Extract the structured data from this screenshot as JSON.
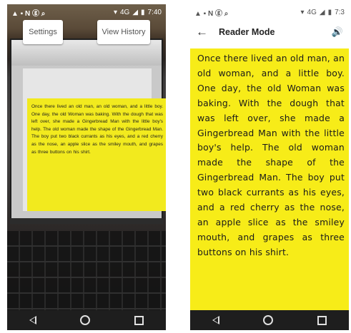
{
  "status_bar": {
    "left_icons": "▲ ▪ N ⓖ ⌕",
    "time_left": "7:40",
    "time_right": "7:3",
    "network": "4G"
  },
  "camera_screen": {
    "settings_label": "Settings",
    "history_label": "View History",
    "recognized_text": "Once there lived an old man, an old woman, and a little boy. One day, the old Woman was baking. With the dough that was left over, she made a Gingerbread Man with the little boy's help. The old woman made the shape of the Gingerbread Man. The boy put two black currants as his eyes, and a red cherry as the nose, an apple slice as the smiley mouth, and grapes as three buttons on his shirt."
  },
  "reader_screen": {
    "back_icon": "←",
    "title": "Reader Mode",
    "speaker_icon": "🔊",
    "text": "Once there lived an old man, an old woman, and a little boy. One day, the old Woman was baking. With the dough that was left over, she made a Gingerbread Man with the little boy's help. The old woman made the shape of the Gingerbread Man. The boy put two black currants as his eyes, and a red cherry as the nose, an apple slice as the smiley mouth, and grapes as three buttons on his shirt."
  },
  "colors": {
    "highlight_yellow": "#f7ec18",
    "nav_bar": "#1e1e1e"
  }
}
